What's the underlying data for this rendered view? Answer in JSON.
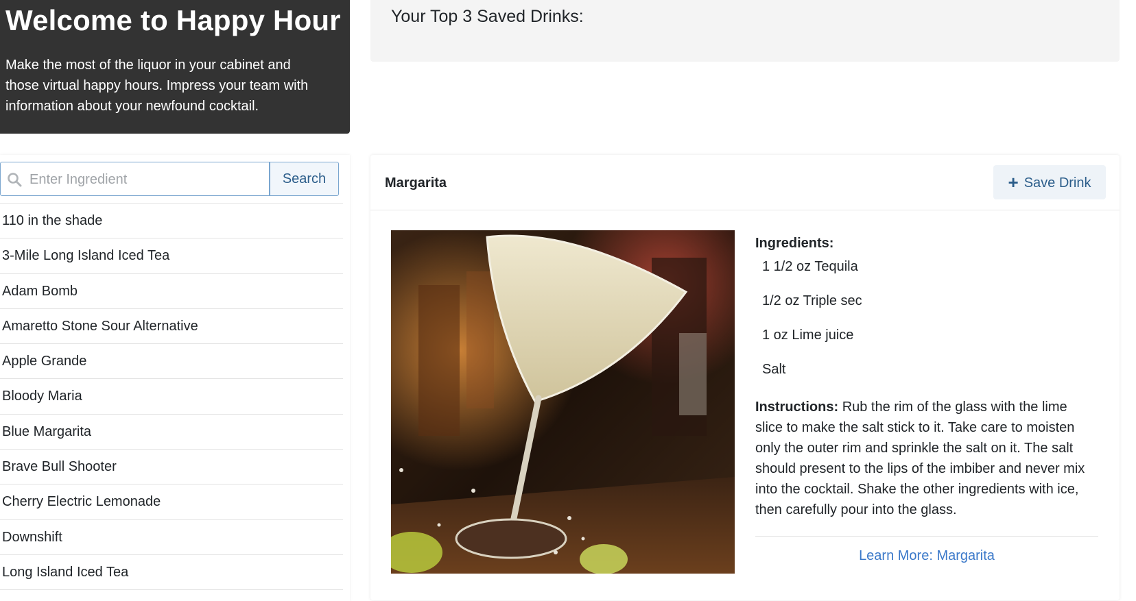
{
  "hero": {
    "title": "Welcome to Happy Hour",
    "description": "Make the most of the liquor in your cabinet and those virtual happy hours. Impress your team with information about your newfound cocktail."
  },
  "saved": {
    "title": "Your Top 3 Saved Drinks:"
  },
  "search": {
    "placeholder": "Enter Ingredient",
    "value": "",
    "button_label": "Search"
  },
  "drink_list": [
    "110 in the shade",
    "3-Mile Long Island Iced Tea",
    "Adam Bomb",
    "Amaretto Stone Sour Alternative",
    "Apple Grande",
    "Bloody Maria",
    "Blue Margarita",
    "Brave Bull Shooter",
    "Cherry Electric Lemonade",
    "Downshift",
    "Long Island Iced Tea"
  ],
  "drink": {
    "name": "Margarita",
    "save_label": "Save Drink",
    "ingredients_title": "Ingredients:",
    "ingredients": [
      "1 1/2 oz Tequila",
      "1/2 oz Triple sec",
      "1 oz Lime juice",
      "Salt"
    ],
    "instructions_label": "Instructions:",
    "instructions": "Rub the rim of the glass with the lime slice to make the salt stick to it. Take care to moisten only the outer rim and sprinkle the salt on it. The salt should present to the lips of the imbiber and never mix into the cocktail. Shake the other ingredients with ice, then carefully pour into the glass.",
    "learn_more": "Learn More: Margarita"
  },
  "colors": {
    "hero_bg": "#333333",
    "accent": "#2b5d8a",
    "link": "#3a78c9"
  }
}
